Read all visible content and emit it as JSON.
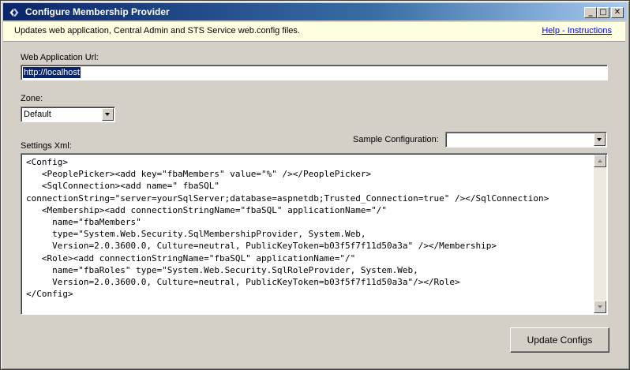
{
  "window": {
    "title": "Configure Membership Provider",
    "controls": {
      "minimize": "_",
      "maximize": "□",
      "close": "✕"
    }
  },
  "infobar": {
    "text": "Updates web application, Central Admin and STS Service web.config files.",
    "help_link": "Help - Instructions"
  },
  "form": {
    "web_app_url_label": "Web Application Url:",
    "web_app_url_value": "http://localhost",
    "zone_label": "Zone:",
    "zone_value": "Default",
    "settings_xml_label": "Settings Xml:",
    "sample_config_label": "Sample Configuration:",
    "sample_config_value": "",
    "settings_xml_value": "<Config>\n   <PeoplePicker><add key=\"fbaMembers\" value=\"%\" /></PeoplePicker>\n   <SqlConnection><add name=\" fbaSQL\"\nconnectionString=\"server=yourSqlServer;database=aspnetdb;Trusted_Connection=true\" /></SqlConnection>\n   <Membership><add connectionStringName=\"fbaSQL\" applicationName=\"/\"\n     name=\"fbaMembers\"\n     type=\"System.Web.Security.SqlMembershipProvider, System.Web,\n     Version=2.0.3600.0, Culture=neutral, PublicKeyToken=b03f5f7f11d50a3a\" /></Membership>\n   <Role><add connectionStringName=\"fbaSQL\" applicationName=\"/\"\n     name=\"fbaRoles\" type=\"System.Web.Security.SqlRoleProvider, System.Web,\n     Version=2.0.3600.0, Culture=neutral, PublicKeyToken=b03f5f7f11d50a3a\"/></Role>\n</Config>"
  },
  "buttons": {
    "update_configs": "Update Configs"
  },
  "colors": {
    "title_bar": "#0a246a",
    "info_bar": "#ffffe1",
    "selection": "#0a246a",
    "link": "#0000ee",
    "face": "#d4d0c8"
  },
  "icons": {
    "app": "app-arrows-icon",
    "dropdown": "chevron-down-icon"
  }
}
